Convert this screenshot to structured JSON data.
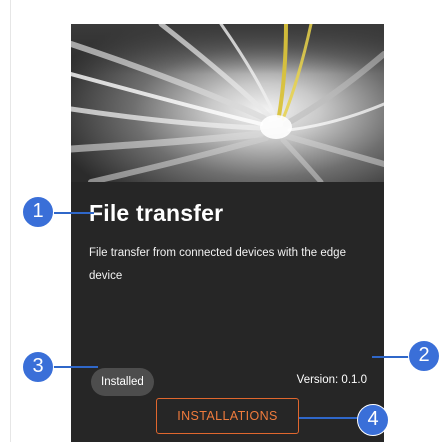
{
  "app": {
    "card": {
      "title": "File transfer",
      "description": "File transfer from connected devices with the edge device",
      "status": "Installed",
      "version": "Version: 0.1.0",
      "action_label": "INSTALLATIONS"
    }
  },
  "callouts": {
    "c1": "1",
    "c2": "2",
    "c3": "3",
    "c4": "4"
  },
  "colors": {
    "card_background": "#262626",
    "action_accent": "#e0672e",
    "callout_blue": "#3a6fd8",
    "badge_background": "#4d4d4d"
  },
  "icons": {
    "hero_image": "tunnel-light-trails-image"
  }
}
